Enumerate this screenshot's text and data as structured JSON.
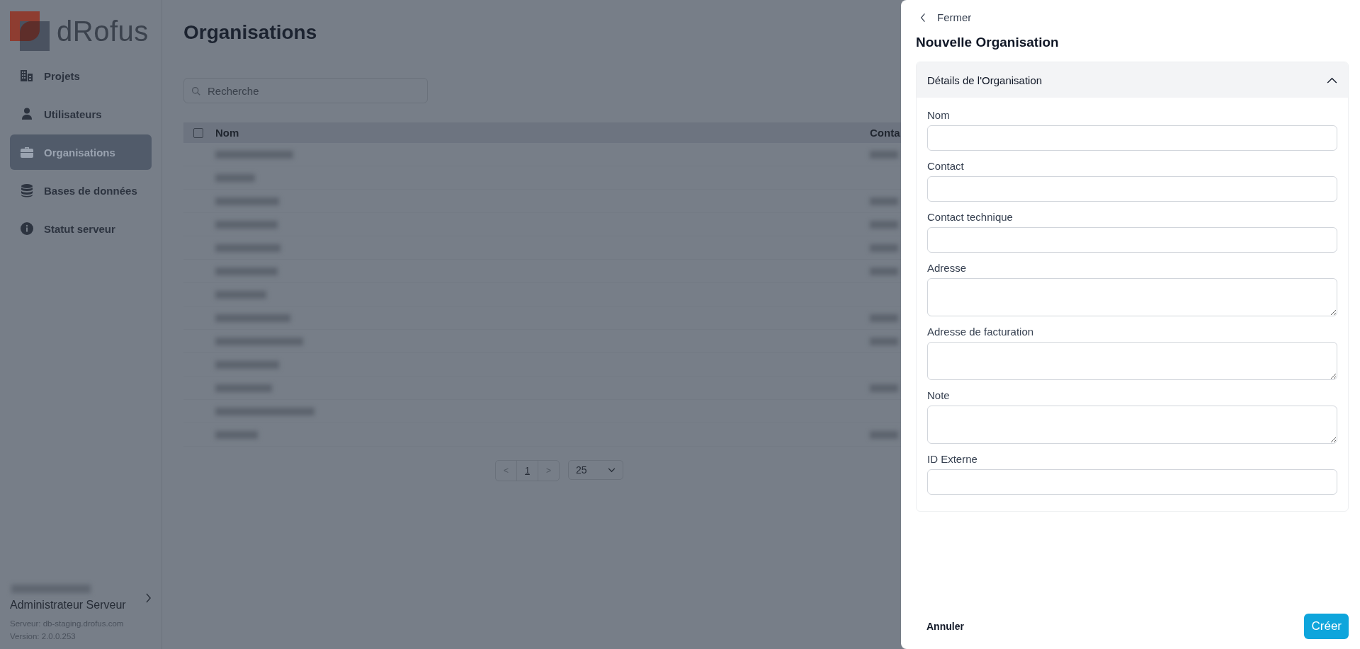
{
  "sidebar": {
    "logo": "dRofus",
    "nav": [
      {
        "label": "Projets",
        "selected": false
      },
      {
        "label": "Utilisateurs",
        "selected": false
      },
      {
        "label": "Organisations",
        "selected": true
      },
      {
        "label": "Bases de données",
        "selected": false
      },
      {
        "label": "Statut serveur",
        "selected": false
      }
    ],
    "user": {
      "role": "Administrateur Serveur",
      "server": "Serveur: db-staging.drofus.com",
      "version": "Version: 2.0.0.253"
    }
  },
  "main": {
    "title": "Organisations",
    "search": {
      "placeholder": "Recherche"
    },
    "table": {
      "columns": [
        "Nom",
        "Conta"
      ],
      "select_all_checked": false,
      "rows": [
        {
          "has_contact": true
        },
        {
          "has_contact": false
        },
        {
          "has_contact": true
        },
        {
          "has_contact": true
        },
        {
          "has_contact": true
        },
        {
          "has_contact": true
        },
        {
          "has_contact": false
        },
        {
          "has_contact": true
        },
        {
          "has_contact": true
        },
        {
          "has_contact": false
        },
        {
          "has_contact": true
        },
        {
          "has_contact": false
        },
        {
          "has_contact": true
        }
      ]
    },
    "pagination": {
      "prev": "<",
      "pages": [
        {
          "label": "1",
          "selected": true
        }
      ],
      "next": ">",
      "page_size": "25"
    }
  },
  "panel": {
    "close": "Fermer",
    "title": "Nouvelle Organisation",
    "section": {
      "title": "Détails de l'Organisation",
      "expanded": true,
      "fields": [
        {
          "label": "Nom",
          "kind": "input"
        },
        {
          "label": "Contact",
          "kind": "input"
        },
        {
          "label": "Contact technique",
          "kind": "input"
        },
        {
          "label": "Adresse",
          "kind": "textarea"
        },
        {
          "label": "Adresse de facturation",
          "kind": "textarea"
        },
        {
          "label": "Note",
          "kind": "textarea"
        },
        {
          "label": "ID Externe",
          "kind": "input"
        }
      ]
    },
    "footer": {
      "cancel": "Annuler",
      "submit": "Créer"
    }
  }
}
